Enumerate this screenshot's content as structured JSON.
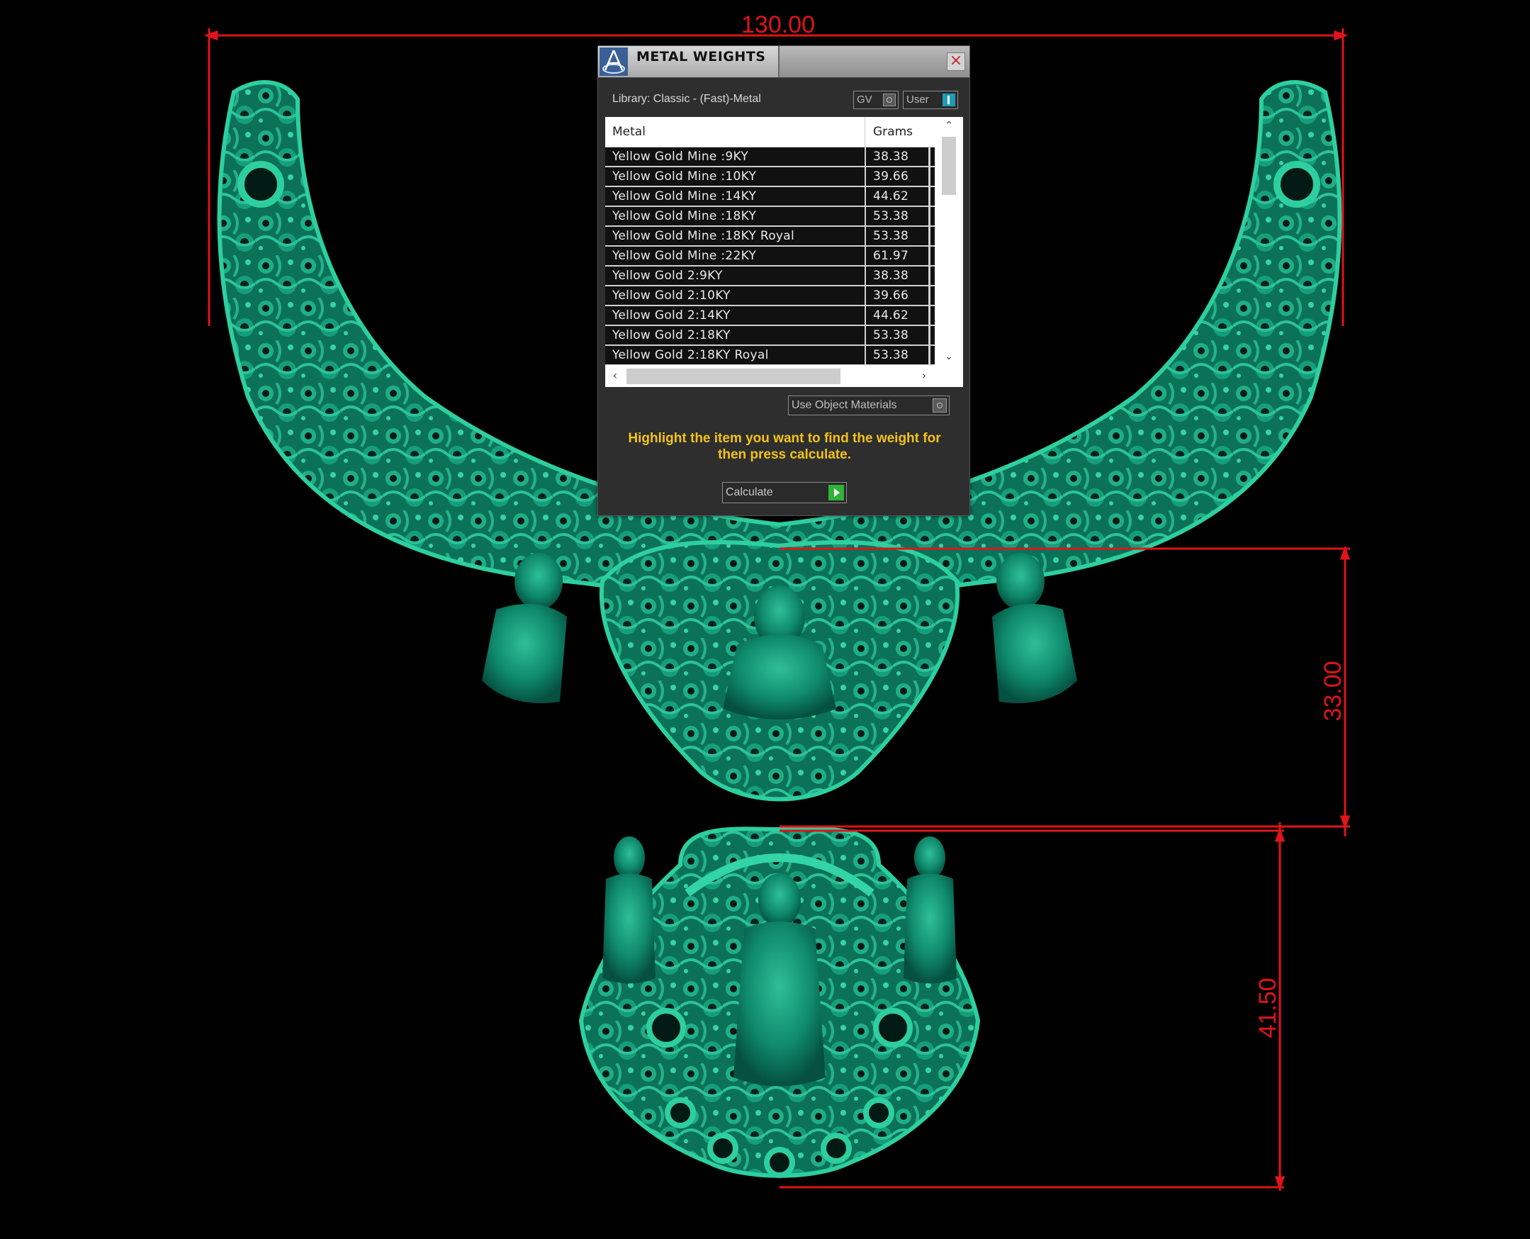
{
  "dimensions": {
    "width_label": "130.00",
    "upper_height_label": "33.00",
    "pendant_height_label": "41.50"
  },
  "dialog": {
    "title": "METAL WEIGHTS",
    "close_symbol": "×",
    "library_label": "Library: Classic - (Fast)-Metal",
    "toggle_gv_label": "GV",
    "toggle_user_label": "User",
    "table": {
      "columns": [
        "Metal",
        "Grams"
      ],
      "rows": [
        {
          "metal": "Yellow Gold Mine :9KY",
          "grams": "38.38"
        },
        {
          "metal": "Yellow Gold Mine :10KY",
          "grams": "39.66"
        },
        {
          "metal": "Yellow Gold Mine :14KY",
          "grams": "44.62"
        },
        {
          "metal": "Yellow Gold Mine :18KY",
          "grams": "53.38"
        },
        {
          "metal": "Yellow Gold Mine :18KY Royal",
          "grams": "53.38"
        },
        {
          "metal": "Yellow Gold Mine :22KY",
          "grams": "61.97"
        },
        {
          "metal": "Yellow Gold 2:9KY",
          "grams": "38.38"
        },
        {
          "metal": "Yellow Gold 2:10KY",
          "grams": "39.66"
        },
        {
          "metal": "Yellow Gold 2:14KY",
          "grams": "44.62"
        },
        {
          "metal": "Yellow Gold 2:18KY",
          "grams": "53.38"
        },
        {
          "metal": "Yellow Gold 2:18KY Royal",
          "grams": "53.38"
        }
      ]
    },
    "scroll_up_icon": "chevron-up-icon",
    "scroll_down_icon": "chevron-down-icon",
    "scroll_left_icon": "chevron-left-icon",
    "scroll_right_icon": "chevron-right-icon",
    "use_object_materials_label": "Use Object Materials",
    "instructions": "Highlight the item you want to find the weight for then press calculate.",
    "calculate_label": "Calculate"
  },
  "colors": {
    "dimension_red": "#e0141a",
    "jewel_green": "#0f8a6c",
    "instruction_yellow": "#f2c318",
    "user_toggle_blue": "#1e9bb6",
    "calculate_green": "#2fb33a"
  }
}
